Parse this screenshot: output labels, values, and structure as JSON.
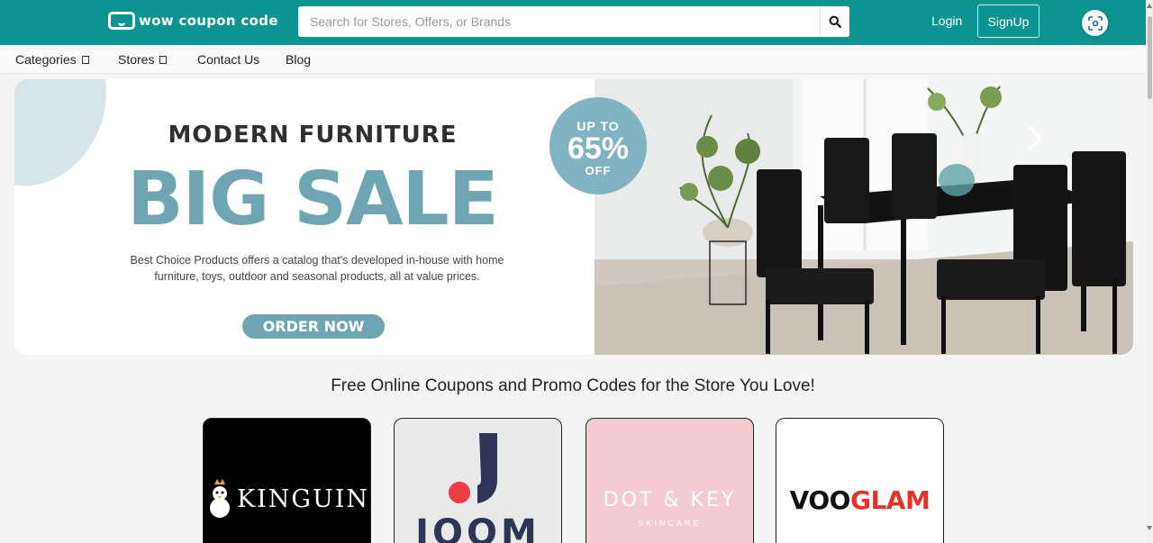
{
  "header": {
    "logo_text": "wow coupon code",
    "search": {
      "placeholder": "Search for Stores, Offers, or Brands",
      "icon": "search-icon"
    },
    "login_label": "Login",
    "signup_label": "SignUp"
  },
  "nav": {
    "items": [
      {
        "label": "Categories",
        "has_dropdown": true
      },
      {
        "label": "Stores",
        "has_dropdown": true
      },
      {
        "label": "Contact Us",
        "has_dropdown": false
      },
      {
        "label": "Blog",
        "has_dropdown": false
      }
    ]
  },
  "banner": {
    "eyebrow": "MODERN FURNITURE",
    "headline": "BIG SALE",
    "description": "Best Choice Products offers a catalog that's developed in-house with home furniture, toys, outdoor and seasonal products, all at value prices.",
    "cta_label": "ORDER NOW",
    "badge": {
      "line1": "UP TO",
      "line2": "65%",
      "line3": "OFF"
    },
    "accent_color": "#6fa5b3"
  },
  "section": {
    "title": "Free Online Coupons and Promo Codes for the Store You Love!"
  },
  "stores": [
    {
      "name": "KINGUIN"
    },
    {
      "name": "JOOM"
    },
    {
      "name": "DOT & KEY",
      "tagline": "SKINCARE"
    },
    {
      "name_part1": "VOO",
      "name_part2": "GLAM"
    }
  ],
  "colors": {
    "brand": "#0b9490",
    "accent": "#6fa5b3",
    "joom_red": "#ef3b45",
    "joom_navy": "#2d3656",
    "vooglam_red": "#e5332a"
  }
}
